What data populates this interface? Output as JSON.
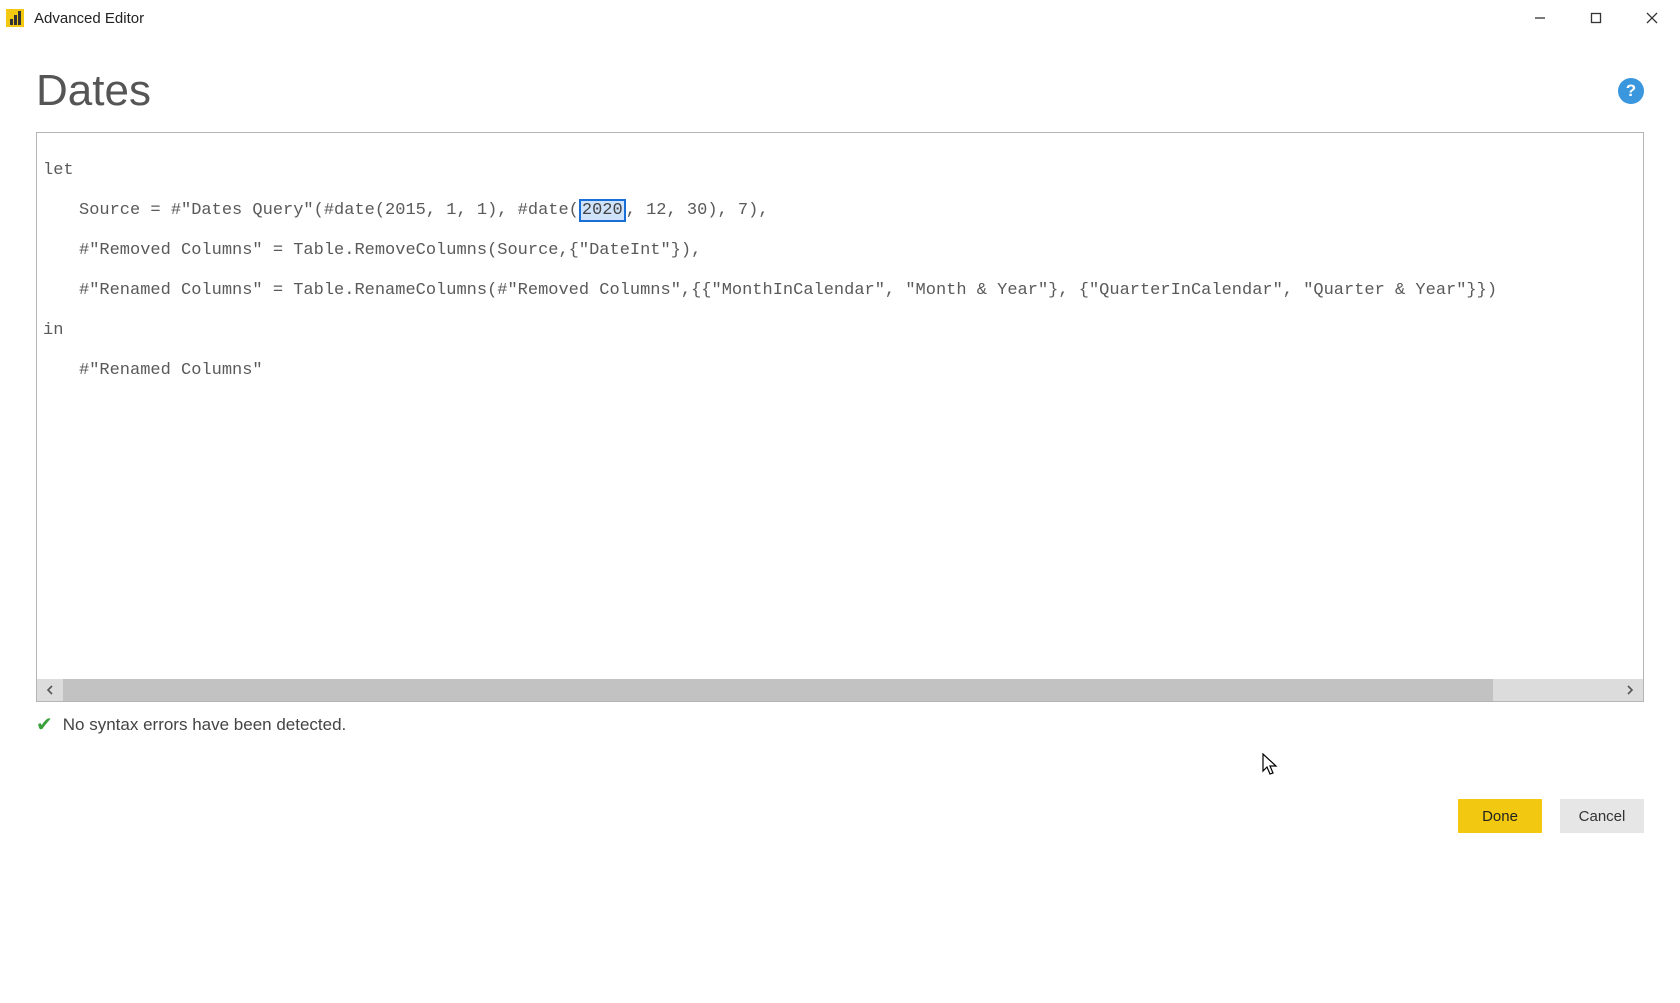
{
  "window": {
    "title": "Advanced Editor"
  },
  "header": {
    "query_name": "Dates"
  },
  "code": {
    "line1": "let",
    "line2_a": "Source = #\"Dates Query\"(#date(2015, 1, 1), #date(",
    "line2_sel": "2020",
    "line2_b": ", 12, 30), 7),",
    "line3": "#\"Removed Columns\" = Table.RemoveColumns(Source,{\"DateInt\"}),",
    "line4": "#\"Renamed Columns\" = Table.RenameColumns(#\"Removed Columns\",{{\"MonthInCalendar\", \"Month & Year\"}, {\"QuarterInCalendar\", \"Quarter & Year\"}})",
    "line5": "in",
    "line6": "#\"Renamed Columns\""
  },
  "status": {
    "message": "No syntax errors have been detected."
  },
  "buttons": {
    "done": "Done",
    "cancel": "Cancel"
  },
  "help": {
    "label": "?"
  }
}
